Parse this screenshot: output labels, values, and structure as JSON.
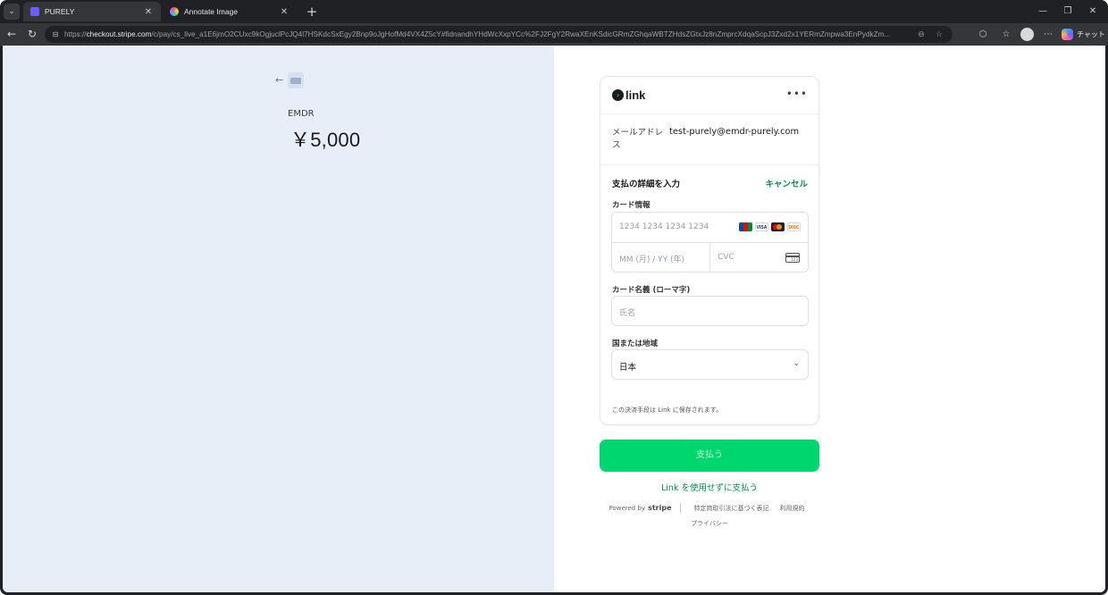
{
  "browser": {
    "tabs": [
      {
        "title": "PURELY",
        "active": true
      },
      {
        "title": "Annotate Image",
        "active": false
      }
    ],
    "url_prefix": "https://",
    "url_host": "checkout.stripe.com",
    "url_path": "/c/pay/cs_live_a1E6jmO2CUxc9kOgjuclPcJQ4l7HSKdcSxEgy2Bnp9oJgHofMd4VX4Z5cY#fidnandhYHdWcXxpYCc%2FJ2FgY2RwaXEnKSdicGRmZGhqaWBTZHdsZGtxJz8nZmprcXdqaScpJ3Zxd2x1YERmZmpwa3EnPydkZm...",
    "copilot_label": "チャット",
    "accent": "#00d66f"
  },
  "merchant": {
    "product_name": "EMDR",
    "price": "￥5,000"
  },
  "link": {
    "brand_word": "link",
    "email_label": "メールアドレス",
    "email_value": "test-purely@emdr-purely.com",
    "section_title": "支払の詳細を入力",
    "cancel_label": "キャンセル",
    "card_info_label": "カード情報",
    "card_number_placeholder": "1234 1234 1234 1234",
    "expiry_placeholder": "MM (月) / YY (年)",
    "cvc_placeholder": "CVC",
    "card_brands": [
      "JCB",
      "VISA",
      "MC",
      "DISC"
    ],
    "cardholder_label": "カード名義 (ローマ字)",
    "cardholder_placeholder": "氏名",
    "country_label": "国または地域",
    "country_value": "日本",
    "save_note": "この決済手段は Link に保存されます。"
  },
  "actions": {
    "pay_label": "支払う",
    "pay_without_link": "Link を使用せずに支払う"
  },
  "footer": {
    "powered_by": "Powered by",
    "stripe": "stripe",
    "legal": "特定商取引法に基づく表記",
    "terms": "利用規約",
    "privacy": "プライバシー"
  }
}
